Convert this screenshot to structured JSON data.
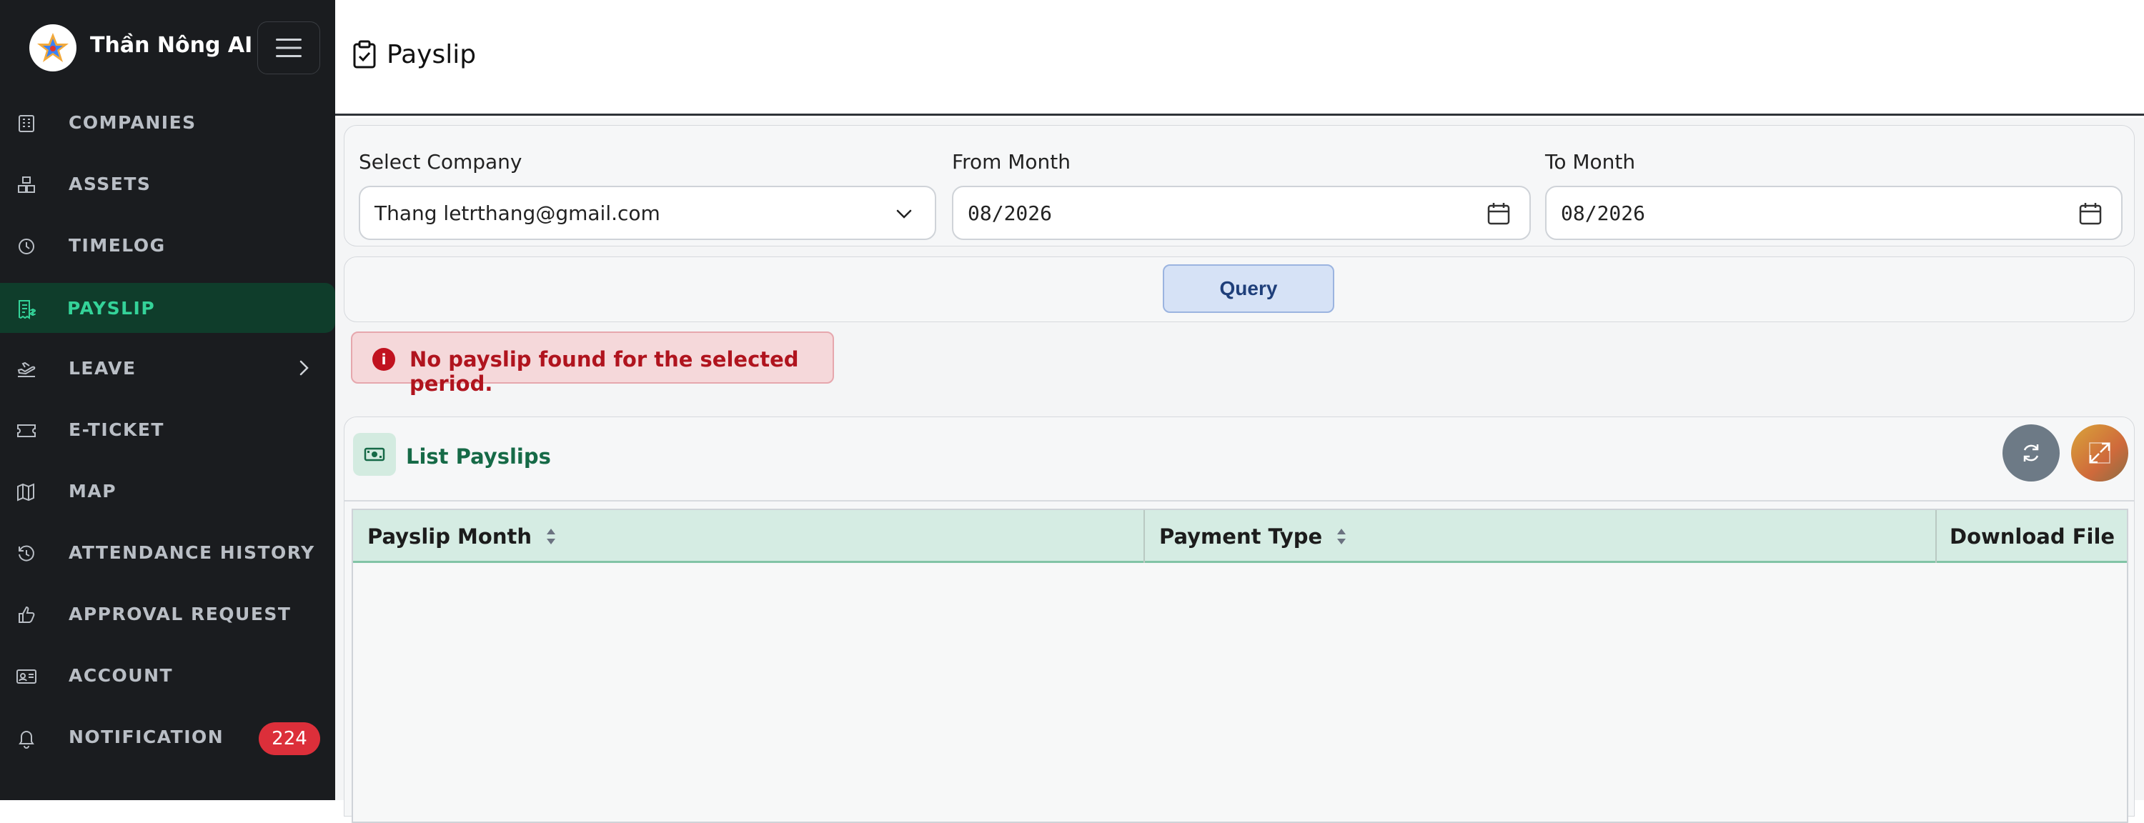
{
  "brand": {
    "name": "Thần Nông AI"
  },
  "nav": {
    "items": [
      {
        "label": "COMPANIES",
        "icon": "building-icon"
      },
      {
        "label": "ASSETS",
        "icon": "boxes-icon"
      },
      {
        "label": "TIMELOG",
        "icon": "clock-icon"
      },
      {
        "label": "PAYSLIP",
        "icon": "receipt-icon",
        "active": true
      },
      {
        "label": "LEAVE",
        "icon": "plane-icon",
        "has_submenu": true
      },
      {
        "label": "E-TICKET",
        "icon": "ticket-icon"
      },
      {
        "label": "MAP",
        "icon": "map-icon"
      },
      {
        "label": "ATTENDANCE HISTORY",
        "icon": "history-icon"
      },
      {
        "label": "APPROVAL REQUEST",
        "icon": "thumbs-up-icon"
      },
      {
        "label": "ACCOUNT",
        "icon": "id-card-icon"
      },
      {
        "label": "NOTIFICATION",
        "icon": "bell-icon",
        "badge": "224"
      }
    ]
  },
  "header": {
    "title": "Payslip"
  },
  "filters": {
    "company_label": "Select Company",
    "company_value": "Thang letrthang@gmail.com",
    "from_label": "From Month",
    "from_value": "08/2026",
    "to_label": "To Month",
    "to_value": "08/2026",
    "query_label": "Query"
  },
  "alert": {
    "message": "No payslip found for the selected period."
  },
  "list": {
    "title": "List Payslips",
    "columns": [
      "Payslip Month",
      "Payment Type",
      "Download File"
    ],
    "rows": []
  },
  "colors": {
    "sidebar_bg": "#1a1c1f",
    "active_green": "#34d399",
    "badge_red": "#dc2f3a",
    "alert_text": "#b0141e",
    "table_header": "#d5ece3"
  }
}
